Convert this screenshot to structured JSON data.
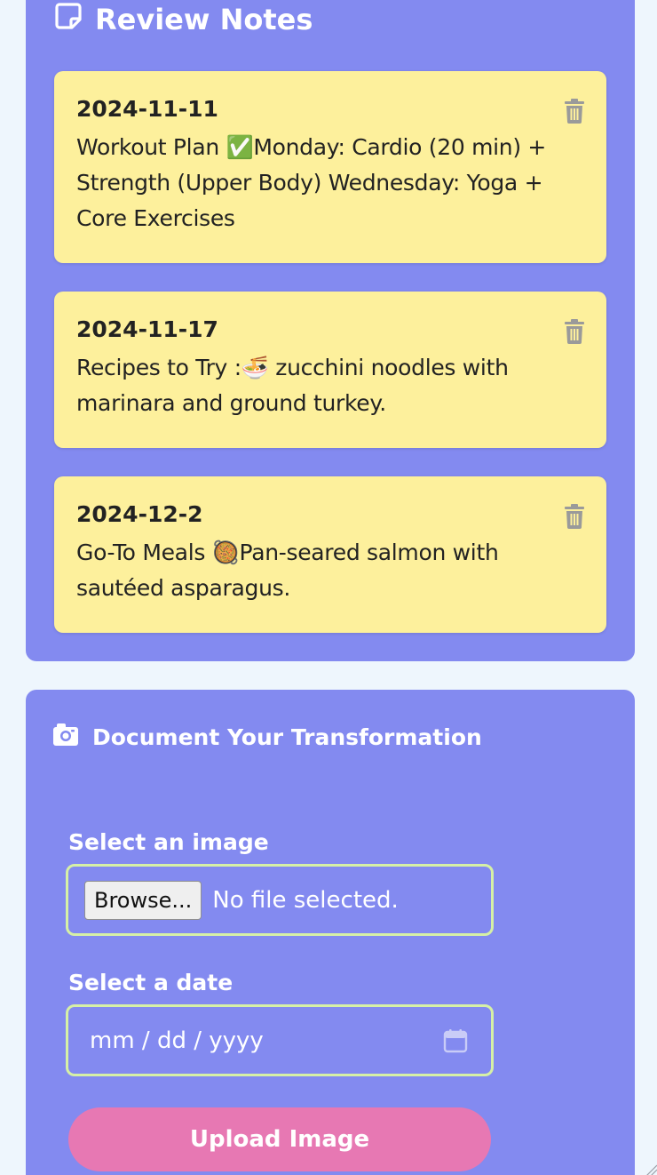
{
  "review_notes": {
    "title": "Review Notes",
    "title_icon": "sticky-note-icon",
    "notes": [
      {
        "date": "2024-11-11",
        "text": "Workout Plan ✅Monday: Cardio (20 min) + Strength (Upper Body) Wednesday: Yoga + Core Exercises",
        "delete_icon": "trash-icon"
      },
      {
        "date": "2024-11-17",
        "text": "Recipes to Try :🍜 zucchini noodles with marinara and ground turkey.",
        "delete_icon": "trash-icon"
      },
      {
        "date": "2024-12-2",
        "text": "Go-To Meals 🥘Pan-seared salmon with sautéed asparagus.",
        "delete_icon": "trash-icon"
      }
    ]
  },
  "upload": {
    "title": "Document Your Transformation",
    "title_icon": "camera-icon",
    "image_label": "Select an image",
    "browse_label": "Browse...",
    "no_file_text": "No file selected.",
    "date_label": "Select a date",
    "date_placeholder": "mm / dd / yyyy",
    "date_icon": "calendar-icon",
    "submit_label": "Upload Image"
  },
  "colors": {
    "page_background": "#eef6fd",
    "panel_background": "#838af0",
    "note_background": "#fdf09c",
    "field_border": "#d6f0a6",
    "upload_button": "#e778b3",
    "trash_icon": "#9a9a9a"
  }
}
